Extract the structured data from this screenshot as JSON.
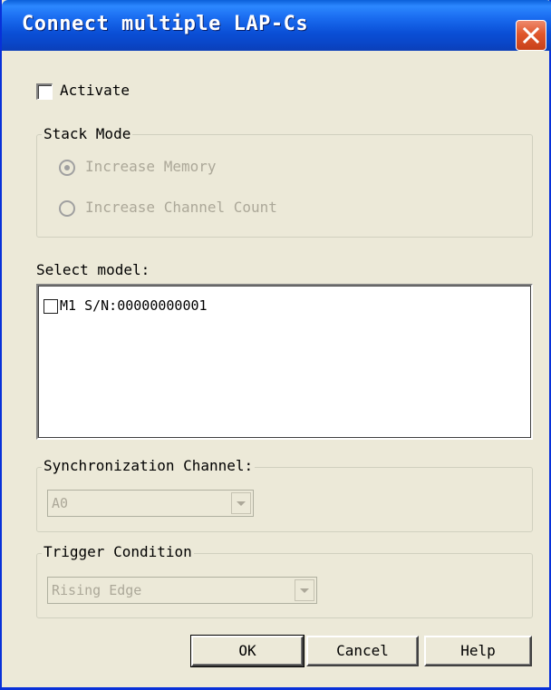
{
  "window": {
    "title": "Connect multiple LAP-Cs"
  },
  "activate": {
    "label": "Activate",
    "checked": false
  },
  "stack_mode": {
    "legend": "Stack Mode",
    "options": [
      {
        "label": "Increase Memory",
        "selected": true
      },
      {
        "label": "Increase Channel Count",
        "selected": false
      }
    ]
  },
  "select_model": {
    "label": "Select model:",
    "items": [
      {
        "label": "M1 S/N:00000000001",
        "checked": false
      }
    ]
  },
  "sync_channel": {
    "legend": "Synchronization Channel:",
    "value": "A0"
  },
  "trigger_condition": {
    "legend": "Trigger Condition",
    "value": "Rising Edge"
  },
  "buttons": {
    "ok": "OK",
    "cancel": "Cancel",
    "help": "Help"
  },
  "colors": {
    "titlebar": "#0a4fd6",
    "face": "#ece9d8",
    "disabled_text": "#aca899",
    "close": "#e0572c"
  }
}
